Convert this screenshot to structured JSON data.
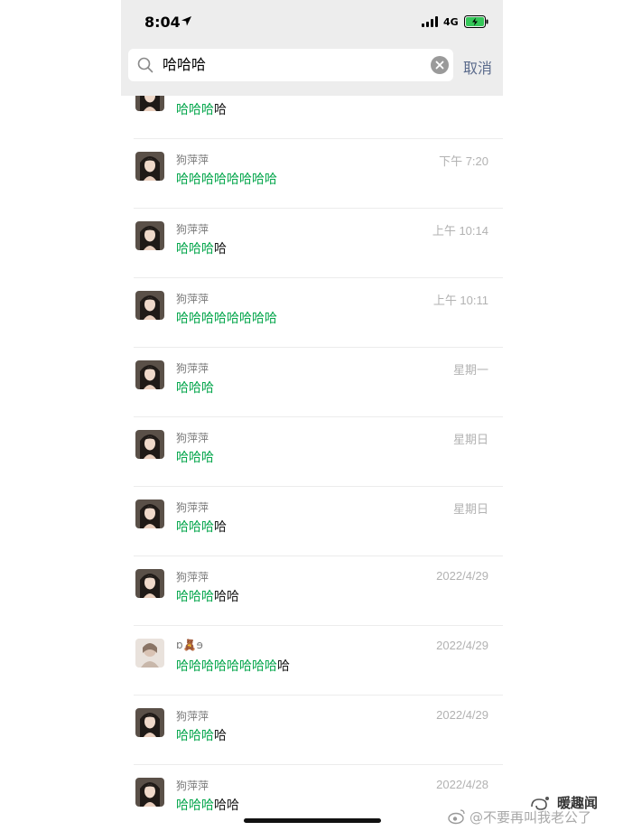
{
  "status_bar": {
    "time": "8:04",
    "network": "4G"
  },
  "search": {
    "query": "哈哈哈",
    "cancel_label": "取消"
  },
  "results": [
    {
      "name": "",
      "time": "",
      "hl": "哈哈哈",
      "rest": "哈"
    },
    {
      "name": "狗萍萍",
      "time": "下午 7:20",
      "hl": "哈哈哈哈哈哈哈哈",
      "rest": ""
    },
    {
      "name": "狗萍萍",
      "time": "上午 10:14",
      "hl": "哈哈哈",
      "rest": "哈"
    },
    {
      "name": "狗萍萍",
      "time": "上午 10:11",
      "hl": "哈哈哈哈哈哈哈哈",
      "rest": ""
    },
    {
      "name": "狗萍萍",
      "time": "星期一",
      "hl": "哈哈哈",
      "rest": ""
    },
    {
      "name": "狗萍萍",
      "time": "星期日",
      "hl": "哈哈哈",
      "rest": ""
    },
    {
      "name": "狗萍萍",
      "time": "星期日",
      "hl": "哈哈哈",
      "rest": "哈"
    },
    {
      "name": "狗萍萍",
      "time": "2022/4/29",
      "hl": "哈哈哈",
      "rest": "哈哈"
    },
    {
      "name": "ɒ🧸ɘ",
      "time": "2022/4/29",
      "hl": "哈哈哈哈哈哈哈哈",
      "rest": "哈"
    },
    {
      "name": "狗萍萍",
      "time": "2022/4/29",
      "hl": "哈哈哈",
      "rest": "哈"
    },
    {
      "name": "狗萍萍",
      "time": "2022/4/28",
      "hl": "哈哈哈",
      "rest": "哈哈"
    }
  ],
  "watermark": {
    "brand": "暖趣闻",
    "weibo": "@不要再叫我老公了"
  },
  "colors": {
    "highlight": "#07a74e",
    "cancel": "#5b6b8c",
    "bar_bg": "#ededed"
  },
  "icons": [
    "location-arrow-icon",
    "signal-icon",
    "battery-charging-icon",
    "search-icon",
    "clear-icon",
    "weibo-logo-icon",
    "brand-logo-icon"
  ]
}
